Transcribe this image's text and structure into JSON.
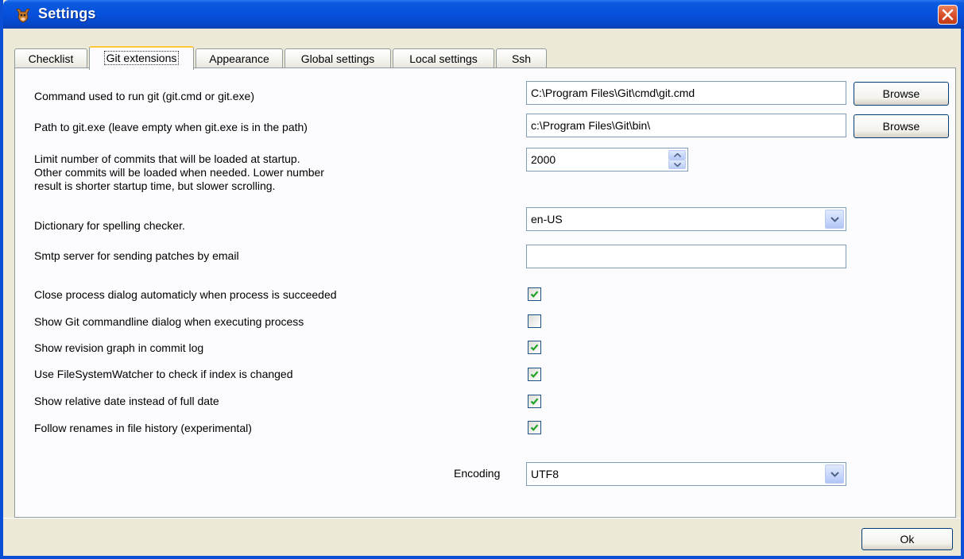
{
  "window": {
    "title": "Settings"
  },
  "tabs": [
    {
      "label": "Checklist"
    },
    {
      "label": "Git extensions"
    },
    {
      "label": "Appearance"
    },
    {
      "label": "Global settings"
    },
    {
      "label": "Local settings"
    },
    {
      "label": "Ssh"
    }
  ],
  "settings": {
    "git_command": {
      "label": "Command used to run git (git.cmd or git.exe)",
      "value": "C:\\Program Files\\Git\\cmd\\git.cmd",
      "browse_label": "Browse"
    },
    "git_path": {
      "label": "Path to git.exe (leave empty when git.exe is in the path)",
      "value": "c:\\Program Files\\Git\\bin\\",
      "browse_label": "Browse"
    },
    "commit_limit": {
      "label_lines": [
        "Limit number of commits that will be loaded at startup.",
        "Other commits will be loaded when needed. Lower number",
        "result is shorter startup time, but slower scrolling."
      ],
      "value": "2000"
    },
    "dictionary": {
      "label": "Dictionary for spelling checker.",
      "value": "en-US"
    },
    "smtp": {
      "label": "Smtp server for sending patches by email",
      "value": ""
    },
    "checkboxes": [
      {
        "label": "Close process dialog automaticly when process is succeeded",
        "checked": true
      },
      {
        "label": "Show Git commandline dialog when executing process",
        "checked": false
      },
      {
        "label": "Show revision graph in commit log",
        "checked": true
      },
      {
        "label": "Use FileSystemWatcher to check if index is changed",
        "checked": true
      },
      {
        "label": "Show relative date instead of full date",
        "checked": true
      },
      {
        "label": "Follow renames in file history (experimental)",
        "checked": true
      }
    ],
    "encoding": {
      "label": "Encoding",
      "value": "UTF8"
    }
  },
  "footer": {
    "ok_label": "Ok"
  },
  "colors": {
    "titlebar": "#0650DB",
    "close": "#D9502A",
    "check": "#21A121"
  }
}
